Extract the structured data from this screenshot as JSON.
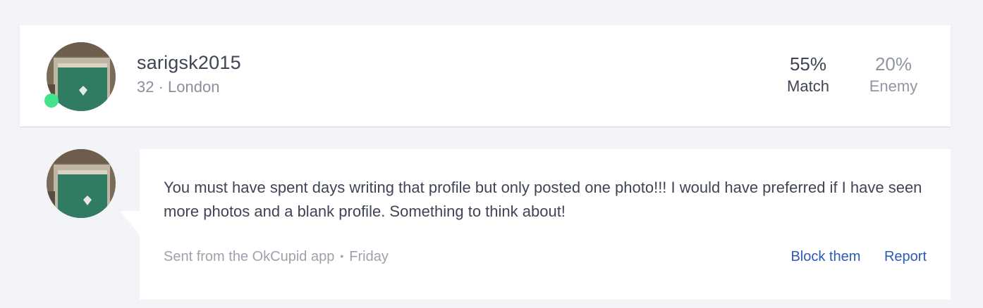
{
  "profile": {
    "username": "sarigsk2015",
    "meta": "32 · London",
    "online": true,
    "match_value": "55%",
    "match_label": "Match",
    "enemy_value": "20%",
    "enemy_label": "Enemy"
  },
  "message": {
    "text": "You must have spent days writing that profile but only posted one photo!!! I would have preferred if I have seen more photos and a blank profile. Something to think about!",
    "source": "Sent from the OkCupid app",
    "separator": "•",
    "time": "Friday",
    "block_label": "Block them",
    "report_label": "Report"
  },
  "colors": {
    "online": "#44e28a",
    "link": "#2a5bb8",
    "text": "#3f4456"
  }
}
